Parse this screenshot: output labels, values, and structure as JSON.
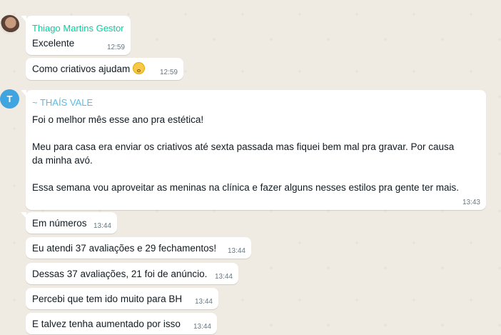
{
  "messages": [
    {
      "sender": "Thiago Martins Gestor",
      "text": "Excelente",
      "time": "12:59"
    },
    {
      "text": "Como criativos ajudam",
      "emoji": "worried-face-emoji",
      "time": "12:59"
    },
    {
      "sender": "~ THAÍS VALE",
      "avatar_letter": "T",
      "paragraphs": [
        "Foi o melhor mês esse ano pra estética!",
        "Meu para casa era enviar os criativos até sexta passada mas fiquei bem mal pra gravar.  Por causa da minha avó.",
        "Essa semana vou aproveitar as meninas na clínica e fazer alguns nesses estilos pra gente ter mais."
      ],
      "time": "13:43"
    },
    {
      "text": "Em números",
      "time": "13:44"
    },
    {
      "text": "Eu atendi 37 avaliações e 29 fechamentos!",
      "time": "13:44"
    },
    {
      "text": "Dessas 37 avaliações, 21 foi de anúncio.",
      "time": "13:44"
    },
    {
      "text": "Percebi que tem ido muito para BH",
      "time": "13:44"
    },
    {
      "text": "E talvez tenha aumentado por isso",
      "time": "13:44"
    }
  ],
  "colors": {
    "chat_background": "#efeae2",
    "bubble": "#ffffff",
    "sender_green": "#06cf9c",
    "sender_blue": "#53bdeb",
    "avatar_blue": "#40a4e0",
    "timestamp": "#667781"
  }
}
